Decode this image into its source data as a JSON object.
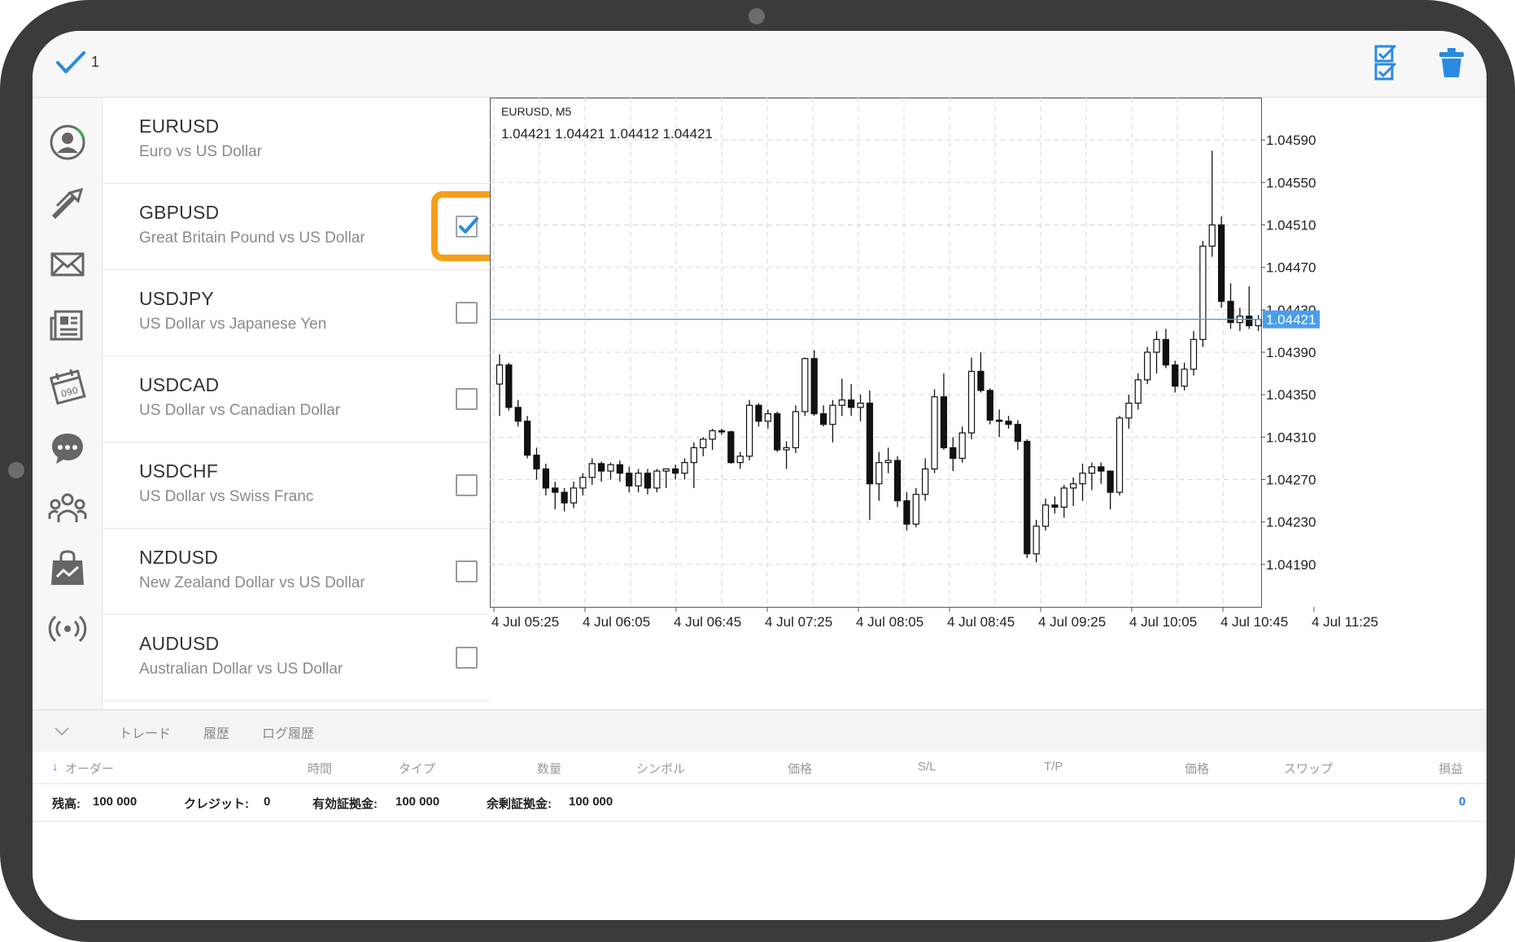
{
  "topbar": {
    "selected_count": "1"
  },
  "symbols": [
    {
      "name": "EURUSD",
      "desc": "Euro vs US Dollar",
      "checked": false
    },
    {
      "name": "GBPUSD",
      "desc": "Great Britain Pound vs US Dollar",
      "checked": true
    },
    {
      "name": "USDJPY",
      "desc": "US Dollar vs Japanese Yen",
      "checked": false
    },
    {
      "name": "USDCAD",
      "desc": "US Dollar vs Canadian Dollar",
      "checked": false
    },
    {
      "name": "USDCHF",
      "desc": "US Dollar vs Swiss Franc",
      "checked": false
    },
    {
      "name": "NZDUSD",
      "desc": "New Zealand Dollar vs US Dollar",
      "checked": false
    },
    {
      "name": "AUDUSD",
      "desc": "Australian Dollar vs US Dollar",
      "checked": false
    }
  ],
  "nav_icons": [
    "account-icon",
    "trade-arrows-icon",
    "mail-icon",
    "news-icon",
    "calendar-icon",
    "chat-icon",
    "community-icon",
    "market-icon",
    "signal-icon"
  ],
  "chart_data": {
    "type": "candlestick",
    "symbol_label": "EURUSD, M5",
    "ohlc_label": "1.04421 1.04421 1.04412 1.04421",
    "current_price": "1.04421",
    "ylim": [
      1.0415,
      1.0463
    ],
    "y_ticks": [
      "1.04590",
      "1.04550",
      "1.04510",
      "1.04470",
      "1.04430",
      "1.04390",
      "1.04350",
      "1.04310",
      "1.04270",
      "1.04230",
      "1.04190"
    ],
    "x_ticks": [
      "4 Jul 05:25",
      "4 Jul 06:05",
      "4 Jul 06:45",
      "4 Jul 07:25",
      "4 Jul 08:05",
      "4 Jul 08:45",
      "4 Jul 09:25",
      "4 Jul 10:05",
      "4 Jul 10:45",
      "4 Jul 11:25"
    ],
    "grid": true,
    "candles": [
      [
        1.0436,
        1.04388,
        1.0433,
        1.04378
      ],
      [
        1.04378,
        1.0438,
        1.04335,
        1.04338
      ],
      [
        1.04338,
        1.04345,
        1.0432,
        1.04325
      ],
      [
        1.04325,
        1.0433,
        1.0429,
        1.04293
      ],
      [
        1.04293,
        1.043,
        1.0427,
        1.0428
      ],
      [
        1.0428,
        1.04285,
        1.04255,
        1.04262
      ],
      [
        1.04262,
        1.04268,
        1.04242,
        1.04258
      ],
      [
        1.04258,
        1.04262,
        1.0424,
        1.04248
      ],
      [
        1.04248,
        1.04268,
        1.04243,
        1.04262
      ],
      [
        1.04262,
        1.04276,
        1.04255,
        1.04272
      ],
      [
        1.04272,
        1.0429,
        1.04265,
        1.04285
      ],
      [
        1.04285,
        1.04287,
        1.04268,
        1.04278
      ],
      [
        1.04278,
        1.04286,
        1.0427,
        1.04284
      ],
      [
        1.04284,
        1.04288,
        1.04268,
        1.04276
      ],
      [
        1.04276,
        1.04282,
        1.04258,
        1.04264
      ],
      [
        1.04264,
        1.0428,
        1.04258,
        1.04276
      ],
      [
        1.04276,
        1.0428,
        1.04256,
        1.04262
      ],
      [
        1.04262,
        1.0428,
        1.04258,
        1.04278
      ],
      [
        1.04278,
        1.0428,
        1.04262,
        1.0428
      ],
      [
        1.0428,
        1.04284,
        1.0427,
        1.04276
      ],
      [
        1.04276,
        1.0429,
        1.0427,
        1.04286
      ],
      [
        1.04286,
        1.04305,
        1.04262,
        1.043
      ],
      [
        1.043,
        1.0431,
        1.04292,
        1.04308
      ],
      [
        1.04308,
        1.04318,
        1.04298,
        1.04316
      ],
      [
        1.04316,
        1.04318,
        1.04312,
        1.04315
      ],
      [
        1.04315,
        1.04316,
        1.04285,
        1.04286
      ],
      [
        1.04286,
        1.04296,
        1.0428,
        1.04292
      ],
      [
        1.04292,
        1.04345,
        1.04288,
        1.0434
      ],
      [
        1.0434,
        1.04342,
        1.0432,
        1.04325
      ],
      [
        1.04325,
        1.04336,
        1.04318,
        1.04332
      ],
      [
        1.04332,
        1.04334,
        1.04296,
        1.04298
      ],
      [
        1.04298,
        1.04306,
        1.0428,
        1.043
      ],
      [
        1.043,
        1.0434,
        1.04295,
        1.04334
      ],
      [
        1.04334,
        1.04385,
        1.0433,
        1.04384
      ],
      [
        1.04384,
        1.04392,
        1.0433,
        1.04332
      ],
      [
        1.04332,
        1.0434,
        1.0432,
        1.04322
      ],
      [
        1.04322,
        1.04345,
        1.04305,
        1.0434
      ],
      [
        1.0434,
        1.04365,
        1.0433,
        1.04345
      ],
      [
        1.04345,
        1.0436,
        1.0433,
        1.04338
      ],
      [
        1.04338,
        1.0435,
        1.04325,
        1.04342
      ],
      [
        1.04342,
        1.04354,
        1.04232,
        1.04266
      ],
      [
        1.04266,
        1.04296,
        1.0425,
        1.04286
      ],
      [
        1.04286,
        1.043,
        1.04276,
        1.04288
      ],
      [
        1.04288,
        1.04292,
        1.04244,
        1.0425
      ],
      [
        1.0425,
        1.04258,
        1.04222,
        1.04228
      ],
      [
        1.04228,
        1.04262,
        1.04225,
        1.04256
      ],
      [
        1.04256,
        1.0429,
        1.0425,
        1.0428
      ],
      [
        1.0428,
        1.04355,
        1.04276,
        1.04348
      ],
      [
        1.04348,
        1.0437,
        1.04298,
        1.043
      ],
      [
        1.043,
        1.0431,
        1.04278,
        1.0429
      ],
      [
        1.0429,
        1.0432,
        1.04286,
        1.04314
      ],
      [
        1.04314,
        1.04385,
        1.04308,
        1.04372
      ],
      [
        1.04372,
        1.0439,
        1.04352,
        1.04354
      ],
      [
        1.04354,
        1.04356,
        1.04322,
        1.04326
      ],
      [
        1.04326,
        1.04336,
        1.0431,
        1.04325
      ],
      [
        1.04325,
        1.0433,
        1.04318,
        1.04322
      ],
      [
        1.04322,
        1.04326,
        1.04298,
        1.04306
      ],
      [
        1.04306,
        1.04308,
        1.04196,
        1.042
      ],
      [
        1.042,
        1.04232,
        1.04192,
        1.04226
      ],
      [
        1.04226,
        1.04252,
        1.04222,
        1.04246
      ],
      [
        1.04246,
        1.04254,
        1.04238,
        1.04244
      ],
      [
        1.04244,
        1.04265,
        1.04234,
        1.04262
      ],
      [
        1.04262,
        1.04272,
        1.04245,
        1.04266
      ],
      [
        1.04266,
        1.04285,
        1.0425,
        1.04276
      ],
      [
        1.04276,
        1.04286,
        1.0426,
        1.04282
      ],
      [
        1.04282,
        1.04286,
        1.04266,
        1.04278
      ],
      [
        1.04278,
        1.04278,
        1.04242,
        1.04258
      ],
      [
        1.04258,
        1.0433,
        1.04255,
        1.04328
      ],
      [
        1.04328,
        1.0435,
        1.04318,
        1.04342
      ],
      [
        1.04342,
        1.0437,
        1.04336,
        1.04364
      ],
      [
        1.04364,
        1.04395,
        1.0436,
        1.0439
      ],
      [
        1.0439,
        1.0441,
        1.0437,
        1.04402
      ],
      [
        1.04402,
        1.04412,
        1.04375,
        1.04378
      ],
      [
        1.04378,
        1.04382,
        1.04352,
        1.04358
      ],
      [
        1.04358,
        1.0438,
        1.04354,
        1.04374
      ],
      [
        1.04374,
        1.0441,
        1.04368,
        1.04402
      ],
      [
        1.04402,
        1.04495,
        1.04395,
        1.0449
      ],
      [
        1.0449,
        1.0458,
        1.0448,
        1.0451
      ],
      [
        1.0451,
        1.04518,
        1.04432,
        1.04438
      ],
      [
        1.04438,
        1.04455,
        1.04412,
        1.04418
      ],
      [
        1.04418,
        1.04432,
        1.0441,
        1.04424
      ],
      [
        1.04424,
        1.04452,
        1.04412,
        1.04415
      ],
      [
        1.04415,
        1.04425,
        1.0441,
        1.04421
      ]
    ]
  },
  "bottom": {
    "tabs": [
      "トレード",
      "履歴",
      "ログ履歴"
    ],
    "columns": [
      "オーダー",
      "時間",
      "タイプ",
      "数量",
      "シンボル",
      "価格",
      "S/L",
      "T/P",
      "価格",
      "スワップ",
      "損益"
    ],
    "summary": {
      "balance_label": "残高:",
      "balance": "100 000",
      "credit_label": "クレジット:",
      "credit": "0",
      "equity_label": "有効証拠金:",
      "equity": "100 000",
      "free_margin_label": "余剰証拠金:",
      "free_margin": "100 000",
      "profit": "0"
    }
  },
  "colors": {
    "accent": "#2a8ae0",
    "highlight": "#f5a01a",
    "price_line": "#4a9ee8"
  }
}
